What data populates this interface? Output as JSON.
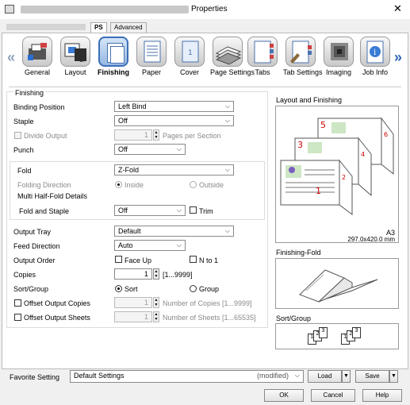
{
  "window": {
    "title": "Properties",
    "close_symbol": "✕"
  },
  "tabs": {
    "ps": "PS",
    "advanced": "Advanced"
  },
  "iconbar": {
    "items": [
      {
        "key": "general",
        "label": "General"
      },
      {
        "key": "layout",
        "label": "Layout"
      },
      {
        "key": "finishing",
        "label": "Finishing",
        "selected": true
      },
      {
        "key": "paper",
        "label": "Paper"
      },
      {
        "key": "cover",
        "label": "Cover"
      },
      {
        "key": "page-settings",
        "label": "Page Settings"
      },
      {
        "key": "tabs",
        "label": "Tabs"
      },
      {
        "key": "tab-settings",
        "label": "Tab Settings"
      },
      {
        "key": "imaging",
        "label": "Imaging"
      },
      {
        "key": "job-info",
        "label": "Job Info"
      }
    ],
    "left_arrow": "«",
    "right_arrow": "»"
  },
  "finishing": {
    "section_label": "Finishing",
    "binding_position": {
      "label": "Binding Position",
      "value": "Left Bind"
    },
    "staple": {
      "label": "Staple",
      "value": "Off"
    },
    "divide_output": {
      "label": "Divide Output",
      "value": "1",
      "unit": "Pages per Section",
      "checked": false,
      "enabled": false
    },
    "punch": {
      "label": "Punch",
      "value": "Off"
    },
    "fold": {
      "label": "Fold",
      "value": "Z-Fold"
    },
    "folding_direction": {
      "label": "Folding Direction",
      "inside": "Inside",
      "outside": "Outside",
      "selected": "inside",
      "enabled": false
    },
    "multi_half_fold": {
      "label": "Multi Half-Fold Details"
    },
    "fold_and_staple": {
      "label": "Fold and Staple",
      "value": "Off",
      "trim_label": "Trim",
      "trim_checked": false
    },
    "output_tray": {
      "label": "Output Tray",
      "value": "Default"
    },
    "feed_direction": {
      "label": "Feed Direction",
      "value": "Auto"
    },
    "output_order": {
      "label": "Output Order",
      "face_up": "Face Up",
      "n_to_1": "N to 1"
    },
    "copies": {
      "label": "Copies",
      "value": "1",
      "range": "[1...9999]"
    },
    "sort_group": {
      "label": "Sort/Group",
      "sort": "Sort",
      "group": "Group",
      "selected": "sort"
    },
    "offset_output_copies": {
      "label": "Offset Output Copies",
      "value": "1",
      "unit": "Number of Copies [1...9999]"
    },
    "offset_output_sheets": {
      "label": "Offset Output Sheets",
      "value": "1",
      "unit": "Number of Sheets [1...65535]"
    }
  },
  "preview": {
    "layout_title": "Layout and Finishing",
    "paper_size": "A3",
    "paper_dims": "297.0x420.0 mm",
    "page_numbers": [
      "1",
      "2",
      "3",
      "4",
      "5",
      "6"
    ],
    "fold_title": "Finishing-Fold",
    "sortgroup_title": "Sort/Group",
    "sort_stack_a": [
      "1",
      "2",
      "3"
    ],
    "sort_stack_b": [
      "1",
      "2",
      "3"
    ]
  },
  "favorite": {
    "label": "Favorite Setting",
    "value": "Default Settings",
    "status": "(modified)",
    "load": "Load",
    "save": "Save"
  },
  "dialog_buttons": {
    "ok": "OK",
    "cancel": "Cancel",
    "help": "Help"
  }
}
